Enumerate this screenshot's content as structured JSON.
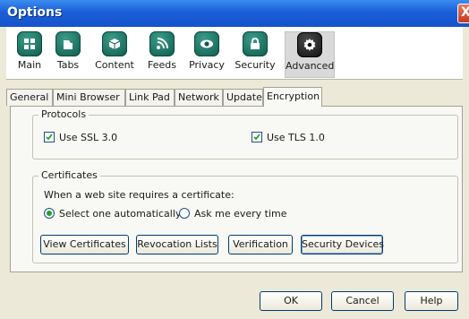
{
  "window": {
    "title": "Options",
    "close_glyph": "X"
  },
  "toolbar": {
    "items": [
      {
        "label": "Main",
        "icon": "main-icon",
        "selected": false
      },
      {
        "label": "Tabs",
        "icon": "tabs-icon",
        "selected": false
      },
      {
        "label": "Content",
        "icon": "content-icon",
        "selected": false
      },
      {
        "label": "Feeds",
        "icon": "feeds-icon",
        "selected": false
      },
      {
        "label": "Privacy",
        "icon": "privacy-icon",
        "selected": false
      },
      {
        "label": "Security",
        "icon": "security-icon",
        "selected": false
      },
      {
        "label": "Advanced",
        "icon": "gear-icon",
        "selected": true
      }
    ]
  },
  "tabs": [
    {
      "label": "General",
      "selected": false
    },
    {
      "label": "Mini Browser",
      "selected": false
    },
    {
      "label": "Link Pad",
      "selected": false
    },
    {
      "label": "Network",
      "selected": false
    },
    {
      "label": "Update",
      "selected": false
    },
    {
      "label": "Encryption",
      "selected": true
    }
  ],
  "protocols": {
    "title": "Protocols",
    "ssl": {
      "label": "Use SSL 3.0",
      "checked": true
    },
    "tls": {
      "label": "Use TLS 1.0",
      "checked": true
    }
  },
  "certificates": {
    "title": "Certificates",
    "prompt": "When a web site requires a certificate:",
    "options": [
      {
        "label": "Select one automatically",
        "checked": true
      },
      {
        "label": "Ask me every time",
        "checked": false
      }
    ],
    "buttons": {
      "view": "View Certificates",
      "revocation": "Revocation Lists",
      "verification": "Verification",
      "devices": "Security Devices"
    }
  },
  "footer": {
    "ok": "OK",
    "cancel": "Cancel",
    "help": "Help"
  },
  "colors": {
    "titlebar": "#1a5fd8",
    "icon_teal": "#0e5a4c",
    "radio_selected": "#21a121",
    "checkbox_mark": "#21a121"
  }
}
